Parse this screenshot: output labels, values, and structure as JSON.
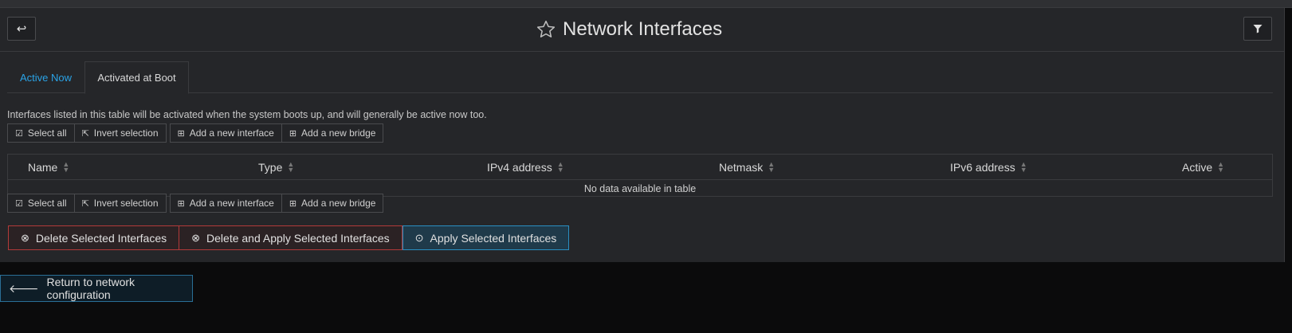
{
  "header": {
    "title": "Network Interfaces",
    "back_icon": "↩",
    "star_icon": "☆",
    "filter_icon": "▼"
  },
  "tabs": [
    {
      "label": "Active Now",
      "active": false
    },
    {
      "label": "Activated at Boot",
      "active": true
    }
  ],
  "description": "Interfaces listed in this table will be activated when the system boots up, and will generally be active now too.",
  "toolbar": {
    "select_all": "Select all",
    "invert_selection": "Invert selection",
    "add_interface": "Add a new interface",
    "add_bridge": "Add a new bridge"
  },
  "table": {
    "columns": [
      "Name",
      "Type",
      "IPv4 address",
      "Netmask",
      "IPv6 address",
      "Active"
    ],
    "empty_message": "No data available in table"
  },
  "actions": {
    "delete": "Delete Selected Interfaces",
    "delete_apply": "Delete and Apply Selected Interfaces",
    "apply": "Apply Selected Interfaces"
  },
  "return_label": "Return to network configuration",
  "colors": {
    "accent": "#2aa3e6",
    "danger": "#b23a3a",
    "primary": "#2a8fc2"
  }
}
